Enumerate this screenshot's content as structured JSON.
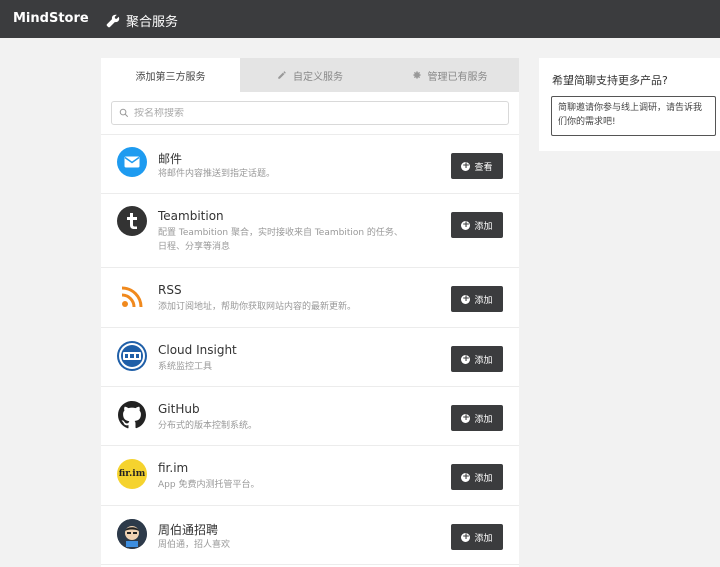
{
  "header": {
    "brand": "MindStore",
    "nav_title": "聚合服务"
  },
  "tabs": [
    {
      "label": "添加第三方服务",
      "icon": "none",
      "active": true
    },
    {
      "label": "自定义服务",
      "icon": "pencil-icon",
      "active": false
    },
    {
      "label": "管理已有服务",
      "icon": "gear-icon",
      "active": false
    }
  ],
  "search": {
    "placeholder": "按名称搜索",
    "value": ""
  },
  "services": [
    {
      "name": "邮件",
      "desc": "将邮件内容推送到指定话题。",
      "button": "查看",
      "logo": "mail-icon",
      "color": "#1e9bf0"
    },
    {
      "name": "Teambition",
      "desc": "配置 Teambition 聚合，实时接收来自 Teambition 的任务、日程、分享等消息",
      "button": "添加",
      "logo": "teambition-logo",
      "color": "#333333"
    },
    {
      "name": "RSS",
      "desc": "添加订阅地址，帮助你获取网站内容的最新更新。",
      "button": "添加",
      "logo": "rss-icon",
      "color": "#f0891d"
    },
    {
      "name": "Cloud Insight",
      "desc": "系统监控工具",
      "button": "添加",
      "logo": "oneapm-logo",
      "color": "#1f5fa8"
    },
    {
      "name": "GitHub",
      "desc": "分布式的版本控制系统。",
      "button": "添加",
      "logo": "github-icon",
      "color": "#222222"
    },
    {
      "name": "fir.im",
      "desc": "App 免费内测托管平台。",
      "button": "添加",
      "logo": "firim-logo",
      "color": "#f5d32e"
    },
    {
      "name": "周伯通招聘",
      "desc": "周伯通，招人喜欢",
      "button": "添加",
      "logo": "zhoubotong-logo",
      "color": "#2d3a4a"
    }
  ],
  "side": {
    "question": "希望简聊支持更多产品?",
    "invite": "简聊邀请你参与线上调研，请告诉我们你的需求吧!"
  }
}
